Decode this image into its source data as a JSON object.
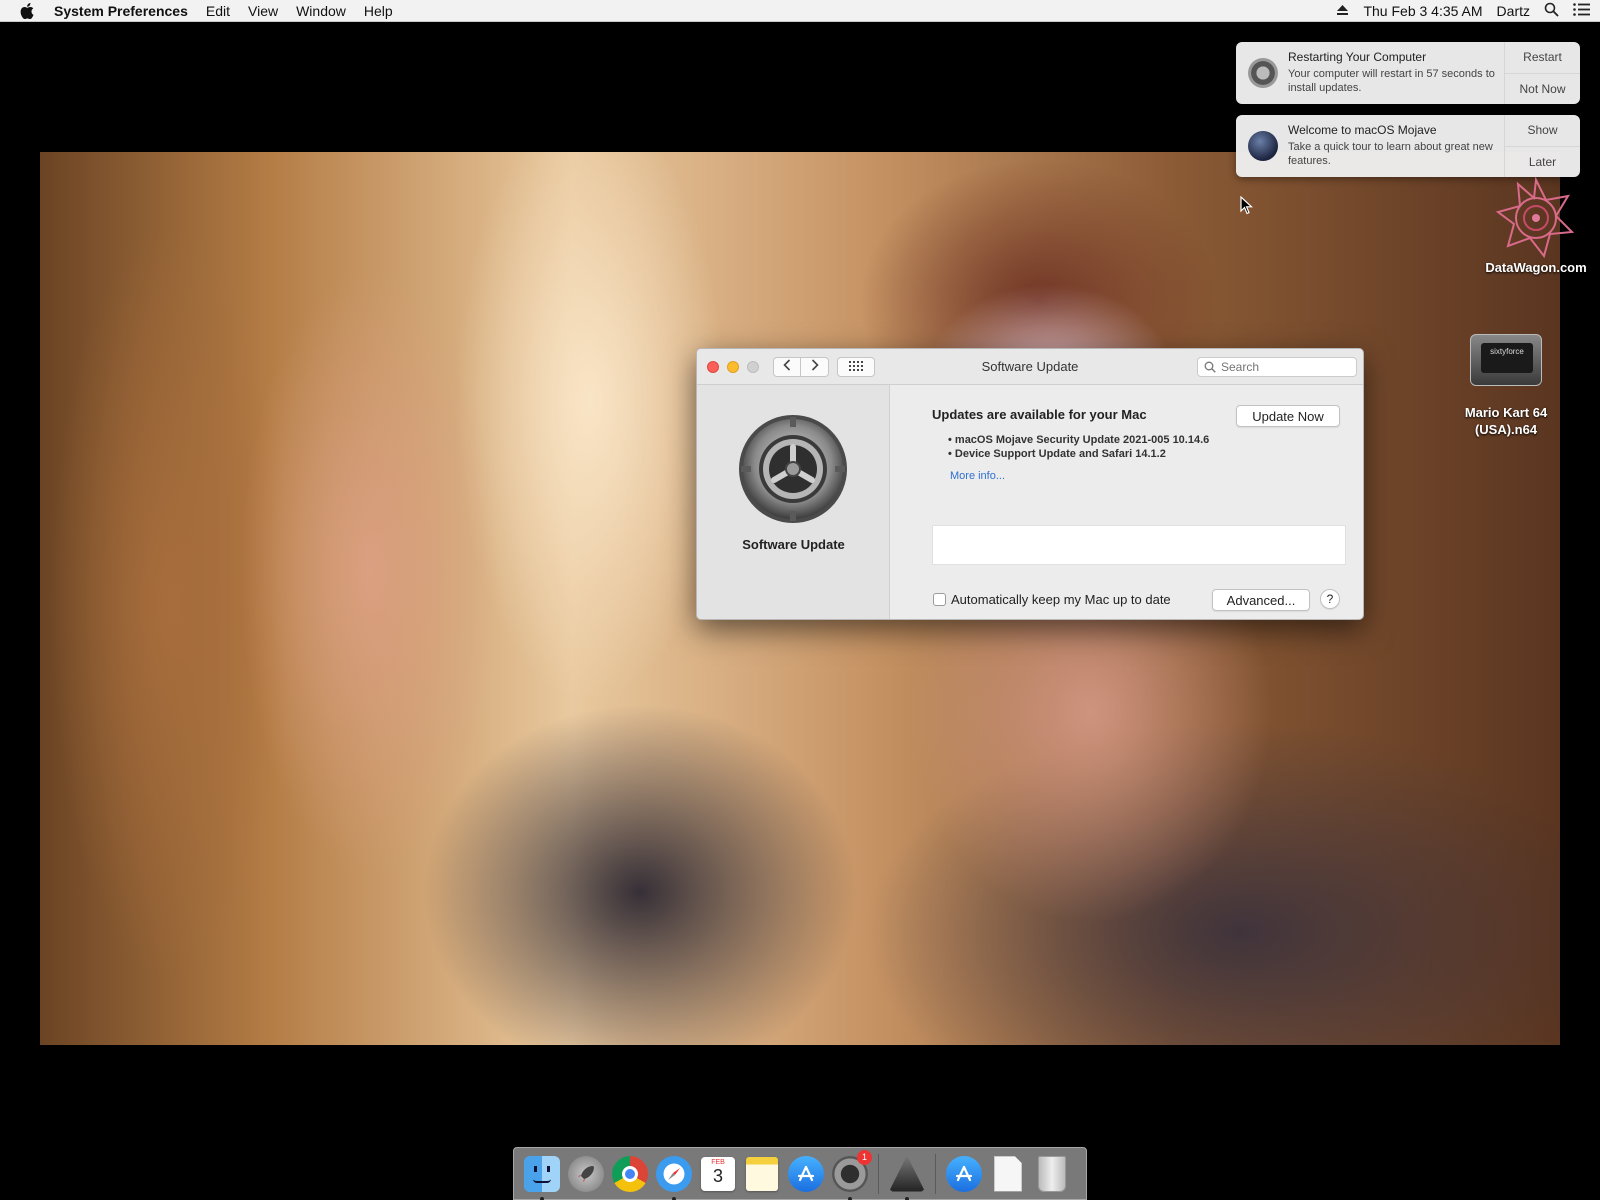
{
  "menubar": {
    "app_name": "System Preferences",
    "menus": [
      "Edit",
      "View",
      "Window",
      "Help"
    ],
    "datetime": "Thu Feb 3  4:35 AM",
    "user": "Dartz"
  },
  "notifications": [
    {
      "title": "Restarting Your Computer",
      "text": "Your computer will restart in 57 seconds to install updates.",
      "action_primary": "Restart",
      "action_secondary": "Not Now",
      "icon": "gear-icon"
    },
    {
      "title": "Welcome to macOS Mojave",
      "text": "Take a quick tour to learn about great new features.",
      "action_primary": "Show",
      "action_secondary": "Later",
      "icon": "mojave-icon"
    }
  ],
  "desktop_icons": [
    {
      "label": "DataWagon.com"
    },
    {
      "label": "Mario Kart 64 (USA).n64",
      "badge": "sixtyforce"
    }
  ],
  "window": {
    "title": "Software Update",
    "search_placeholder": "Search",
    "pane_label": "Software Update",
    "heading": "Updates are available for your Mac",
    "updates": [
      "• macOS Mojave Security Update 2021-005 10.14.6",
      "• Device Support Update  and Safari 14.1.2"
    ],
    "more_info": "More info...",
    "update_now": "Update Now",
    "auto_update_label": "Automatically keep my Mac up to date",
    "auto_update_checked": false,
    "advanced": "Advanced...",
    "help": "?"
  },
  "dock": {
    "calendar_month": "FEB",
    "calendar_day": "3",
    "prefs_badge": "1",
    "items": [
      "Finder",
      "Launchpad",
      "Google Chrome",
      "Safari",
      "Calendar",
      "Notes",
      "App Store",
      "System Preferences",
      "Console",
      "App Store",
      "Document",
      "Trash"
    ]
  }
}
